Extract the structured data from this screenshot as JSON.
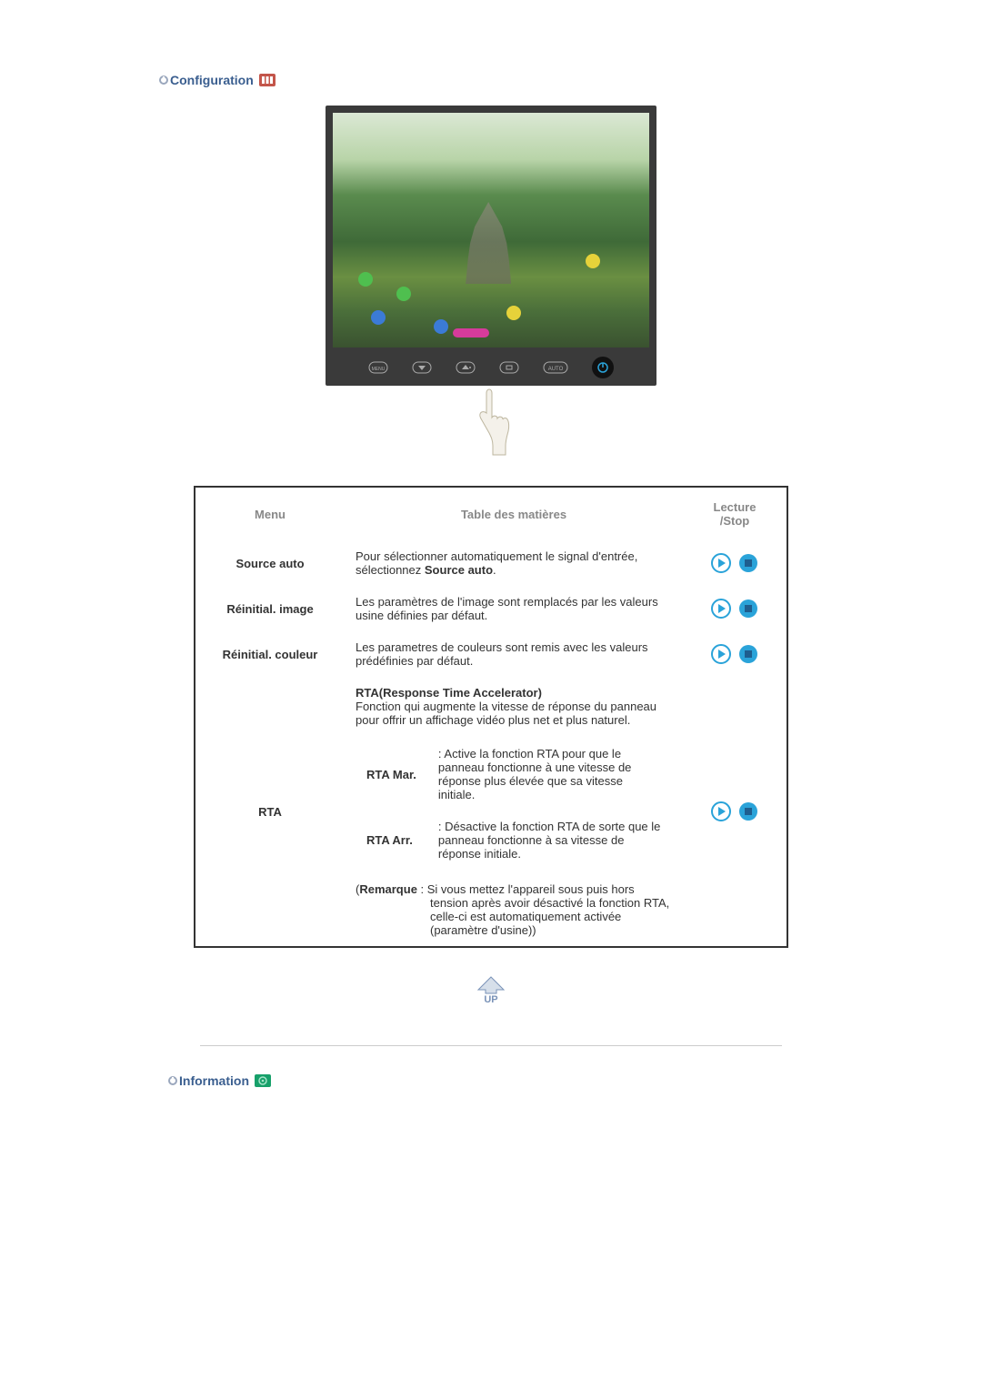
{
  "sections": {
    "configuration_title": "Configuration",
    "information_title": "Information"
  },
  "table": {
    "headers": {
      "menu": "Menu",
      "contents": "Table des matières",
      "play_stop1": "Lecture",
      "play_stop2": "/Stop"
    },
    "rows": {
      "source_auto": {
        "menu": "Source auto",
        "desc_prefix": "Pour sélectionner automatiquement le signal d'entrée, sélectionnez ",
        "desc_bold": "Source auto",
        "desc_suffix": "."
      },
      "reinit_image": {
        "menu": "Réinitial. image",
        "desc": "Les paramètres de l'image sont remplacés par les valeurs usine définies par défaut."
      },
      "reinit_color": {
        "menu": "Réinitial. couleur",
        "desc": "Les parametres de couleurs sont remis avec les valeurs prédéfinies par défaut."
      },
      "rta": {
        "menu": "RTA",
        "title": "RTA(Response Time Accelerator)",
        "intro": "Fonction qui augmente la vitesse de réponse du panneau pour offrir un affichage vidéo plus net et plus naturel.",
        "opt_on_label": "RTA Mar.",
        "opt_on_desc": ": Active la fonction RTA pour que le panneau fonctionne à une vitesse de réponse plus élevée que sa vitesse initiale.",
        "opt_off_label": "RTA Arr.",
        "opt_off_desc": ": Désactive la fonction RTA de sorte que le panneau fonctionne à sa vitesse de réponse initiale.",
        "remark_label": "Remarque",
        "remark_text_line1": " : Si vous mettez l'appareil sous puis hors",
        "remark_text_line2": "tension après avoir désactivé la fonction RTA,",
        "remark_text_line3": "celle-ci est automatiquement activée",
        "remark_text_line4": "(paramètre d'usine))"
      }
    }
  },
  "monitor_buttons": {
    "auto_label": "AUTO"
  },
  "up_label": "UP"
}
